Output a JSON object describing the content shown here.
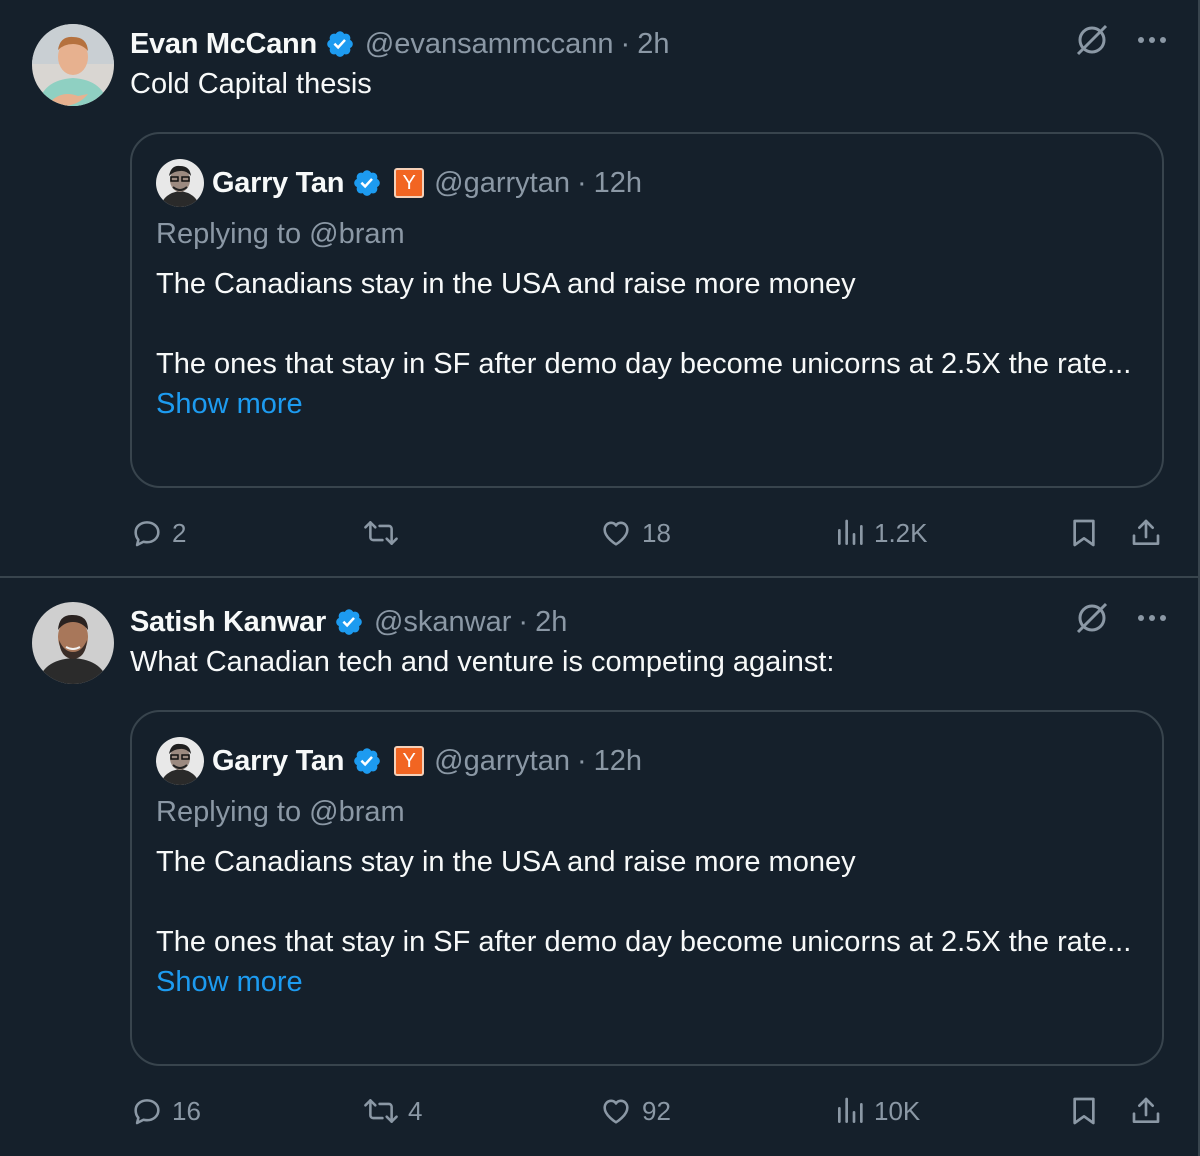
{
  "tweets": [
    {
      "author_name": "Evan McCann",
      "author_handle": "@evansammccann",
      "separator": "·",
      "time": "2h",
      "text": "Cold Capital thesis",
      "quote": {
        "author_name": "Garry Tan",
        "badge": "Y",
        "author_handle": "@garrytan",
        "separator": "·",
        "time": "12h",
        "replying": "Replying to @bram",
        "para1": "The Canadians stay in the USA and raise more money",
        "para2": "The ones that stay in SF after demo day become unicorns at 2.5X the rate...",
        "show_more": "Show more"
      },
      "replies": "2",
      "reposts": "",
      "likes": "18",
      "views": "1.2K"
    },
    {
      "author_name": "Satish Kanwar",
      "author_handle": "@skanwar",
      "separator": "·",
      "time": "2h",
      "text": "What Canadian tech and venture is competing against:",
      "quote": {
        "author_name": "Garry Tan",
        "badge": "Y",
        "author_handle": "@garrytan",
        "separator": "·",
        "time": "12h",
        "replying": "Replying to @bram",
        "para1": "The Canadians stay in the USA and raise more money",
        "para2": "The ones that stay in SF after demo day become unicorns at 2.5X the rate...",
        "show_more": "Show more"
      },
      "replies": "16",
      "reposts": "4",
      "likes": "92",
      "views": "10K"
    }
  ],
  "colors": {
    "background": "#15202b",
    "border": "#38444d",
    "text_primary": "#f7f9f9",
    "text_secondary": "#8b98a5",
    "link": "#1d9bf0",
    "verified": "#1d9bf0",
    "yc_orange": "#f26522"
  },
  "icons": [
    "verified-badge-icon",
    "grok-icon",
    "more-icon",
    "reply-icon",
    "repost-icon",
    "like-icon",
    "views-icon",
    "bookmark-icon",
    "share-icon"
  ]
}
